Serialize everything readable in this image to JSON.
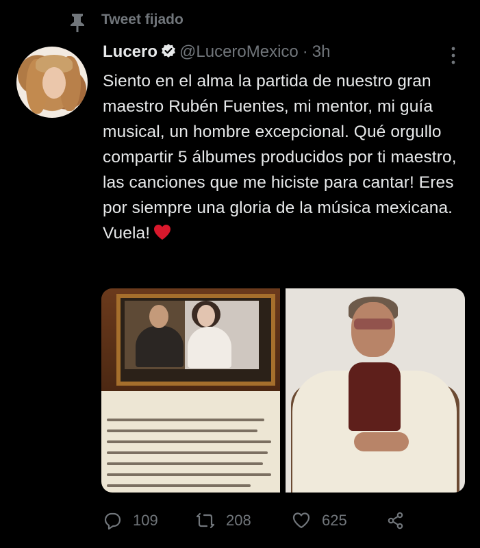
{
  "pinned": {
    "label": "Tweet fijado",
    "icon": "pin-icon"
  },
  "author": {
    "display_name": "Lucero",
    "handle": "@LuceroMexico",
    "separator": "·",
    "timestamp": "3h",
    "verified": true
  },
  "tweet": {
    "text": "Siento en el alma la partida de nuestro gran maestro Rubén Fuentes, mi mentor, mi guía musical, un hombre excepcional. Qué orgullo compartir 5 álbumes producidos por ti maestro, las canciones que me hiciste para cantar! Eres por siempre una gloria de la música mexicana. Vuela!",
    "emoji": "red-heart"
  },
  "media": {
    "count": 2,
    "items": [
      "photo-album-booklet",
      "photo-man-in-cardigan"
    ]
  },
  "actions": {
    "reply_count": "109",
    "retweet_count": "208",
    "like_count": "625"
  },
  "colors": {
    "background": "#000000",
    "text_primary": "#e7e9ea",
    "text_secondary": "#71767b",
    "heart": "#d9182c"
  }
}
